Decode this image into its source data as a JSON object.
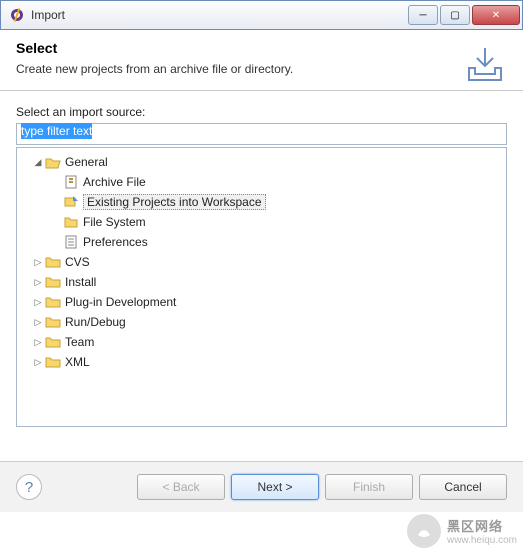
{
  "window": {
    "title": "Import",
    "minimize": "─",
    "maximize": "▢",
    "close": "✕"
  },
  "header": {
    "title": "Select",
    "description": "Create new projects from an archive file or directory."
  },
  "content": {
    "label": "Select an import source:",
    "filter_placeholder": "type filter text"
  },
  "tree": {
    "general": {
      "label": "General",
      "children": {
        "archive": "Archive File",
        "existing": "Existing Projects into Workspace",
        "filesystem": "File System",
        "preferences": "Preferences"
      }
    },
    "cvs": "CVS",
    "install": "Install",
    "plugin": "Plug-in Development",
    "rundebug": "Run/Debug",
    "team": "Team",
    "xml": "XML"
  },
  "buttons": {
    "back": "< Back",
    "next": "Next >",
    "finish": "Finish",
    "cancel": "Cancel"
  },
  "watermark": {
    "main": "黑区网络",
    "sub": "www.heiqu.com"
  }
}
